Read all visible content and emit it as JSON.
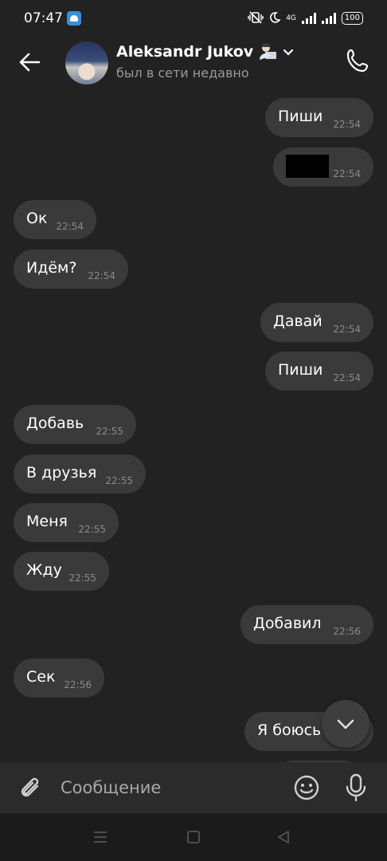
{
  "status_bar": {
    "time": "07:47",
    "network": "4G",
    "battery": "100"
  },
  "header": {
    "contact_name": "Aleksandr Jukov",
    "status": "был в сети недавно",
    "icons": [
      "back-arrow-icon",
      "avatar",
      "technologist-emoji-icon",
      "chevron-down-icon",
      "phone-icon"
    ]
  },
  "messages": [
    {
      "side": "out",
      "text": "Пиши",
      "time": "22:54"
    },
    {
      "side": "out",
      "text": "",
      "time": "22:54",
      "redacted": true
    },
    {
      "side": "in",
      "text": "Ок",
      "time": "22:54"
    },
    {
      "side": "in",
      "text": "Идём?",
      "time": "22:54"
    },
    {
      "side": "out",
      "text": "Давай",
      "time": "22:54"
    },
    {
      "side": "out",
      "text": "Пиши",
      "time": "22:54"
    },
    {
      "side": "in",
      "text": "Добавь",
      "time": "22:55"
    },
    {
      "side": "in",
      "text": "В друзья",
      "time": "22:55"
    },
    {
      "side": "in",
      "text": "Меня",
      "time": "22:55"
    },
    {
      "side": "in",
      "text": "Жду",
      "time": "22:55"
    },
    {
      "side": "out",
      "text": "Добавил",
      "time": "22:56"
    },
    {
      "side": "in",
      "text": "Сек",
      "time": "22:56"
    },
    {
      "side": "out",
      "text": "Я боюсь",
      "time": ""
    }
  ],
  "composer": {
    "placeholder": "Сообщение"
  },
  "colors": {
    "background": "#222222",
    "bubble": "#3a3a3a",
    "timestamp": "#8a8a8a",
    "composer": "#2b2b2b"
  }
}
